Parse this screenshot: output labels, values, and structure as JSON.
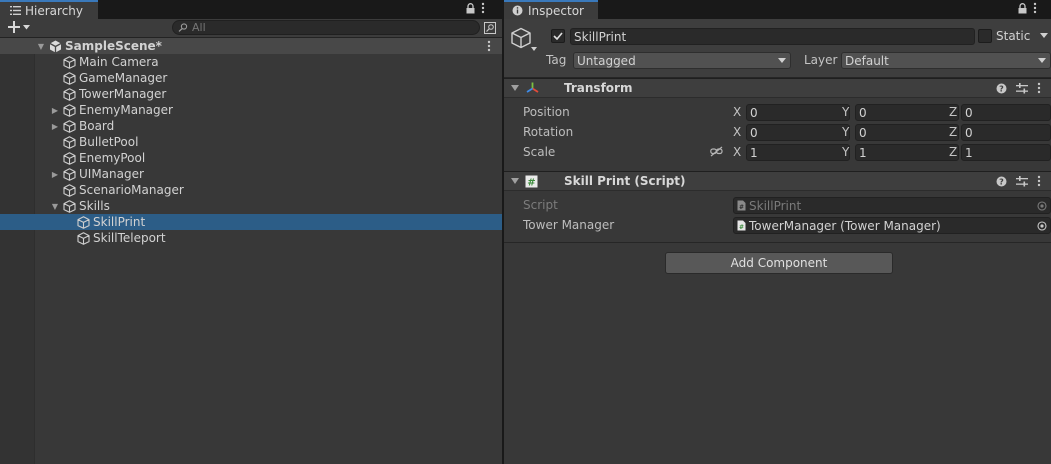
{
  "colors": {
    "selection": "#2c5d87",
    "tab_accent": "#3a79bb",
    "panel_bg": "#383838"
  },
  "hierarchy": {
    "tab_label": "Hierarchy",
    "search_placeholder": "All",
    "scene_name": "SampleScene*",
    "items": [
      {
        "label": "Main Camera",
        "has_children": false,
        "expanded": false,
        "depth": 1
      },
      {
        "label": "GameManager",
        "has_children": false,
        "expanded": false,
        "depth": 1
      },
      {
        "label": "TowerManager",
        "has_children": false,
        "expanded": false,
        "depth": 1
      },
      {
        "label": "EnemyManager",
        "has_children": true,
        "expanded": false,
        "depth": 1
      },
      {
        "label": "Board",
        "has_children": true,
        "expanded": false,
        "depth": 1
      },
      {
        "label": "BulletPool",
        "has_children": false,
        "expanded": false,
        "depth": 1
      },
      {
        "label": "EnemyPool",
        "has_children": false,
        "expanded": false,
        "depth": 1
      },
      {
        "label": "UIManager",
        "has_children": true,
        "expanded": false,
        "depth": 1
      },
      {
        "label": "ScenarioManager",
        "has_children": false,
        "expanded": false,
        "depth": 1
      },
      {
        "label": "Skills",
        "has_children": true,
        "expanded": true,
        "depth": 1
      },
      {
        "label": "SkillPrint",
        "has_children": false,
        "expanded": false,
        "depth": 2,
        "selected": true
      },
      {
        "label": "SkillTeleport",
        "has_children": false,
        "expanded": false,
        "depth": 2
      }
    ]
  },
  "inspector": {
    "tab_label": "Inspector",
    "object_name": "SkillPrint",
    "active": true,
    "static_label": "Static",
    "tag_label": "Tag",
    "tag_value": "Untagged",
    "layer_label": "Layer",
    "layer_value": "Default",
    "transform": {
      "title": "Transform",
      "position_label": "Position",
      "rotation_label": "Rotation",
      "scale_label": "Scale",
      "axis_x": "X",
      "axis_y": "Y",
      "axis_z": "Z",
      "position": {
        "x": "0",
        "y": "0",
        "z": "0"
      },
      "rotation": {
        "x": "0",
        "y": "0",
        "z": "0"
      },
      "scale": {
        "x": "1",
        "y": "1",
        "z": "1"
      }
    },
    "script_component": {
      "title": "Skill Print (Script)",
      "script_label": "Script",
      "script_value": "SkillPrint",
      "tower_manager_label": "Tower Manager",
      "tower_manager_value": "TowerManager (Tower Manager)"
    },
    "add_component_label": "Add Component"
  }
}
